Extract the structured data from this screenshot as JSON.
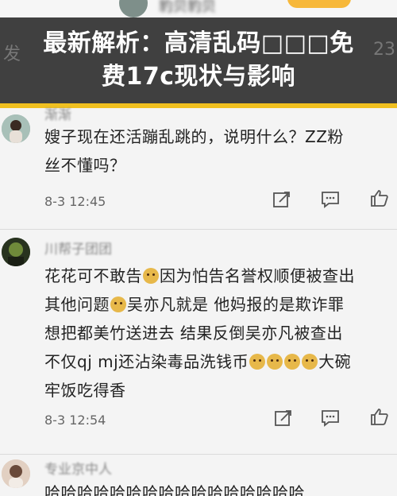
{
  "banner": {
    "title_line1": "最新解析：高清乱码□□□免",
    "title_line2": "费17c现状与影响",
    "left_fragment": "发",
    "right_fragment": "23"
  },
  "top_strip": {
    "username": "豹贝豹贝"
  },
  "comments": [
    {
      "username": "渐渐",
      "lines": [
        "嫂子现在还活蹦乱跳的，说明什么？ZZ粉",
        "丝不懂吗？"
      ],
      "time": "8-3 12:45"
    },
    {
      "username": "川帮子团团",
      "lines": [
        "花花可不敢告",
        "因为怕告名誉权顺便被查出",
        "其他问题",
        "吴亦凡就是 他妈报的是欺诈罪",
        "想把都美竹送进去 结果反倒吴亦凡被查出",
        "不仅qj mj还沾染毒品洗钱币",
        "大碗",
        "牢饭吃得香"
      ],
      "time": "8-3 12:54"
    },
    {
      "username": "专业京中人",
      "lines": [
        "哈哈哈哈哈哈哈哈哈哈哈哈哈哈哈哈"
      ]
    }
  ],
  "icons": {
    "share": "share-icon",
    "comment": "comment-icon",
    "like": "thumbs-up-icon"
  },
  "colors": {
    "banner_bg": "#222222",
    "accent": "#f0c020"
  }
}
